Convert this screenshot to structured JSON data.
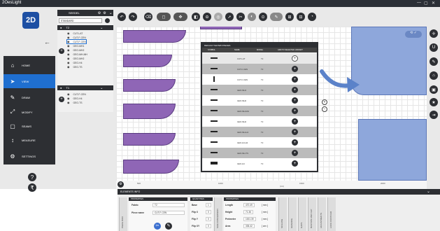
{
  "window": {
    "title": "2OesLight",
    "controls": [
      "—",
      "▢",
      "✕"
    ]
  },
  "logo": {
    "text": "2D"
  },
  "nav": {
    "back_icon": "←",
    "items": [
      {
        "label": "HOME",
        "icon": "home-icon",
        "glyph": "⌂"
      },
      {
        "label": "VIEW",
        "icon": "cursor-icon",
        "glyph": "➤"
      },
      {
        "label": "DRAW",
        "icon": "pencil-icon",
        "glyph": "✎"
      },
      {
        "label": "MODIFY",
        "icon": "resize-icon",
        "glyph": "⤢"
      },
      {
        "label": "SEAMS",
        "icon": "seam-icon",
        "glyph": "▢"
      },
      {
        "label": "MEASURE",
        "icon": "ruler-icon",
        "glyph": "↕"
      },
      {
        "label": "SETTINGS",
        "icon": "settings-icon",
        "glyph": "⚙"
      }
    ],
    "help_icon": "?",
    "currency_icon": "₹"
  },
  "layers": {
    "model_label": "SEEDEL",
    "model_controls": [
      "⚙",
      "⚙",
      "⌄"
    ],
    "standard_value": "STANDARD",
    "groups": [
      {
        "name": "T2",
        "items": [
          "CUT-LAT",
          "CUT-F-CEN",
          "CUT-F-CEN",
          "GEO-MH1",
          "GEO-MH2",
          "GEO-MH-MH",
          "GEO-MH2",
          "GEO-H4",
          "GEO-TS"
        ],
        "selected": 2
      },
      {
        "name": "T1",
        "items": [
          "CUT-F-CEN",
          "GEO-H4",
          "GEO-TS"
        ],
        "selected": -1
      }
    ]
  },
  "toolbar": {
    "icons": [
      "undo-icon",
      "redo-icon",
      "erase-icon",
      "select-icon",
      "move-icon",
      "layer-icon",
      "delete-icon",
      "target-icon",
      "pin-icon",
      "cut-icon",
      "fill-icon",
      "link-icon",
      "pen-icon",
      "grid-icon",
      "group-icon",
      "curve-icon",
      "shape-icon",
      "tool-icon"
    ],
    "glyphs": [
      "↶",
      "↷",
      "⌫",
      "◻",
      "✥",
      "◧",
      "⊖",
      "◎",
      "➚",
      "✂",
      "◐",
      "⊙",
      "✎",
      "⊞",
      "⊟",
      "◔",
      "▲",
      "✐"
    ]
  },
  "right_toolbar": {
    "icons": [
      "crosshair-icon",
      "magnet-icon",
      "pencil-icon",
      "lock-icon",
      "save-icon",
      "star-icon",
      "export-icon"
    ],
    "glyphs": [
      "✛",
      "U",
      "✎",
      "⌂",
      "▣",
      "★",
      "⇥"
    ]
  },
  "dialog": {
    "title": "DEFAULT SHOWN PIECES",
    "columns": [
      "SYMBOL",
      "NAME",
      "MODEL",
      "ADD TO SELECTED VARIANT"
    ],
    "rows": [
      {
        "name": "CUT-LAT",
        "model": "T2"
      },
      {
        "name": "CUT-F-CEN",
        "model": "T2"
      },
      {
        "name": "CUT-F-CEN",
        "model": "T2"
      },
      {
        "name": "GEO-MH1",
        "model": "T2"
      },
      {
        "name": "GEO-MH2",
        "model": "T2"
      },
      {
        "name": "GEO-MH-MH",
        "model": "T2"
      },
      {
        "name": "GEO-MH2",
        "model": "T2"
      },
      {
        "name": "GEO-MH-H4",
        "model": "T2"
      },
      {
        "name": "GEO-H4-H2",
        "model": "T2"
      },
      {
        "name": "GEO-MH-TS",
        "model": "T2"
      },
      {
        "name": "GEO-H4",
        "model": "T2"
      }
    ],
    "add_glyph": "+"
  },
  "ruler": {
    "ticks": [
      "500",
      "1000",
      "1500",
      "2000"
    ],
    "unit": "(mm)"
  },
  "elements_info": {
    "title": "ELEMENTS INFO",
    "collapse_glyph": "⌄",
    "properties": {
      "title": "PROPERTIES",
      "fabric_label": "Fabric",
      "fabric_value": "T2",
      "piece_label": "Piece name",
      "piece_value": "CUT-F-CEN"
    },
    "quantities": {
      "title": "QUANTITIES",
      "rows": [
        {
          "label": "Base",
          "value": "1"
        },
        {
          "label": "Flip X",
          "value": "0"
        },
        {
          "label": "Flip Y",
          "value": "0"
        },
        {
          "label": "Flip XY",
          "value": "0"
        }
      ]
    },
    "measures": {
      "title": "PROPERTIES",
      "rows": [
        {
          "label": "Length",
          "value": "470.49",
          "unit": "[ mm ]"
        },
        {
          "label": "Height",
          "value": "71.36",
          "unit": "[ mm ]"
        },
        {
          "label": "Perimeter",
          "value": "1001.39",
          "unit": "[ mm ]"
        },
        {
          "label": "Area",
          "value": "335.42",
          "unit": "[ cm² ]"
        }
      ]
    },
    "side_tabs": [
      "PIECE INFO",
      "SIZE CONVERSION",
      "SCALING",
      "GRADING",
      "GAPS",
      "BASTION AND FLIP",
      "ADJUSTMENTS",
      "LOCK CONTOUR"
    ]
  },
  "colors": {
    "dark": "#2d2f33",
    "accent": "#1f6fd0",
    "purple": "#8f66b6",
    "blue": "#8ea7db"
  }
}
